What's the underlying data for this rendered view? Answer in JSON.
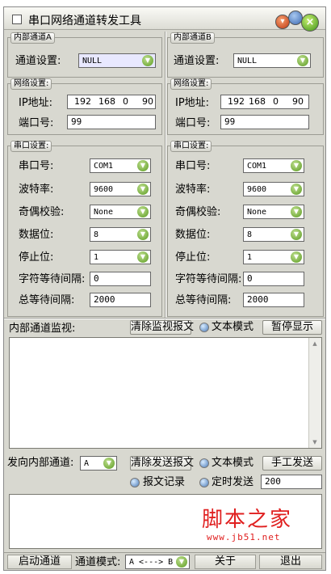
{
  "window": {
    "title": "串口网络通道转发工具"
  },
  "channel_a": {
    "group_label": "内部通道A",
    "channel_setting_label": "通道设置:",
    "channel_setting_value": "NULL",
    "network": {
      "group_label": "网络设置:",
      "ip_label": "IP地址:",
      "ip_octets": [
        "192",
        "168",
        "0",
        "90"
      ],
      "port_label": "端口号:",
      "port_value": "99"
    },
    "serial": {
      "group_label": "串口设置:",
      "port_label": "串口号:",
      "port_value": "COM1",
      "baud_label": "波特率:",
      "baud_value": "9600",
      "parity_label": "奇偶校验:",
      "parity_value": "None",
      "databits_label": "数据位:",
      "databits_value": "8",
      "stopbits_label": "停止位:",
      "stopbits_value": "1",
      "char_wait_label": "字符等待间隔:",
      "char_wait_value": "0",
      "total_wait_label": "总等待间隔:",
      "total_wait_value": "2000"
    }
  },
  "channel_b": {
    "group_label": "内部通道B",
    "channel_setting_label": "通道设置:",
    "channel_setting_value": "NULL",
    "network": {
      "group_label": "网络设置:",
      "ip_label": "IP地址:",
      "ip_octets": [
        "192",
        "168",
        "0",
        "90"
      ],
      "port_label": "端口号:",
      "port_value": "99"
    },
    "serial": {
      "group_label": "串口设置:",
      "port_label": "串口号:",
      "port_value": "COM1",
      "baud_label": "波特率:",
      "baud_value": "9600",
      "parity_label": "奇偶校验:",
      "parity_value": "None",
      "databits_label": "数据位:",
      "databits_value": "8",
      "stopbits_label": "停止位:",
      "stopbits_value": "1",
      "char_wait_label": "字符等待间隔:",
      "char_wait_value": "0",
      "total_wait_label": "总等待间隔:",
      "total_wait_value": "2000"
    }
  },
  "monitor": {
    "label": "内部通道监视:",
    "clear_button": "清除监视报文",
    "text_mode": "文本模式",
    "pause_button": "暂停显示"
  },
  "send": {
    "target_label": "发向内部通道:",
    "target_value": "A",
    "clear_button": "清除发送报文",
    "text_mode": "文本模式",
    "manual_send_button": "手工发送",
    "log_label": "报文记录",
    "timed_send_label": "定时发送",
    "timed_interval_value": "200"
  },
  "watermark": {
    "main": "脚本之家",
    "url": "www.jb51.net"
  },
  "statusbar": {
    "start_button": "启动通道",
    "mode_label": "通道模式:",
    "mode_value": "A <---> B",
    "about_button": "关于",
    "exit_button": "退出"
  }
}
